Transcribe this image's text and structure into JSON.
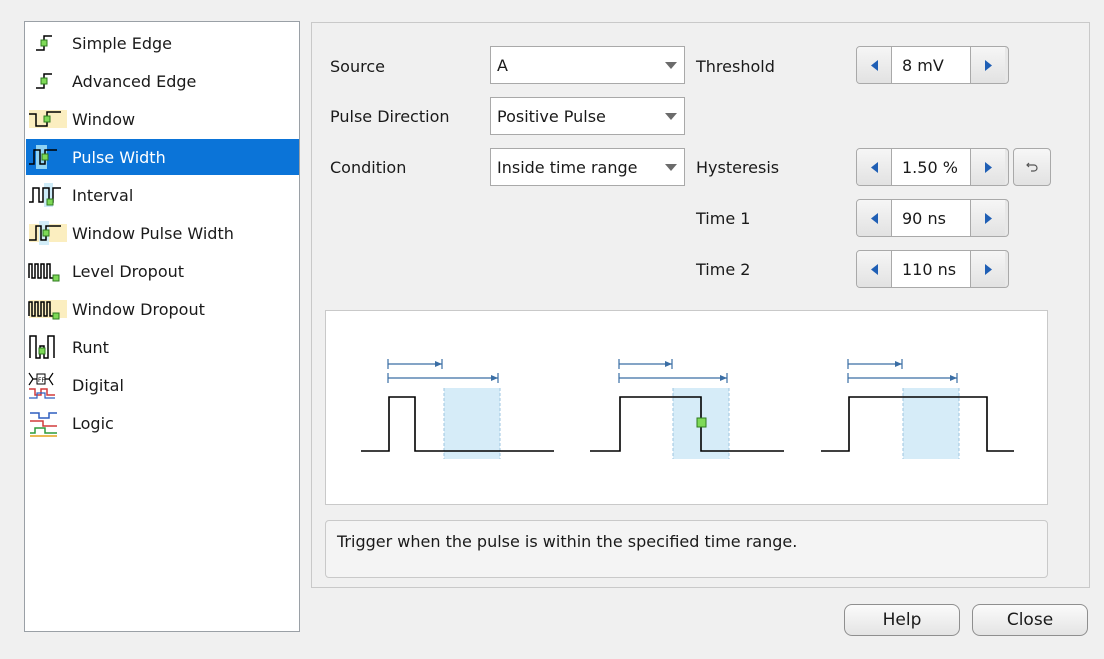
{
  "trigger_types": [
    {
      "label": "Simple Edge",
      "icon": "simple-edge-icon"
    },
    {
      "label": "Advanced Edge",
      "icon": "advanced-edge-icon"
    },
    {
      "label": "Window",
      "icon": "window-icon"
    },
    {
      "label": "Pulse Width",
      "icon": "pulse-width-icon",
      "selected": true
    },
    {
      "label": "Interval",
      "icon": "interval-icon"
    },
    {
      "label": "Window Pulse Width",
      "icon": "window-pulse-width-icon"
    },
    {
      "label": "Level Dropout",
      "icon": "level-dropout-icon"
    },
    {
      "label": "Window Dropout",
      "icon": "window-dropout-icon"
    },
    {
      "label": "Runt",
      "icon": "runt-icon"
    },
    {
      "label": "Digital",
      "icon": "digital-icon"
    },
    {
      "label": "Logic",
      "icon": "logic-icon"
    }
  ],
  "settings": {
    "source_label": "Source",
    "source_value": "A",
    "pulse_direction_label": "Pulse Direction",
    "pulse_direction_value": "Positive Pulse",
    "condition_label": "Condition",
    "condition_value": "Inside time range",
    "threshold_label": "Threshold",
    "threshold_value": "8 mV",
    "hysteresis_label": "Hysteresis",
    "hysteresis_value": "1.50 %",
    "time1_label": "Time 1",
    "time1_value": "90 ns",
    "time2_label": "Time 2",
    "time2_value": "110 ns"
  },
  "description": "Trigger when the pulse is within the specified time range.",
  "buttons": {
    "help": "Help",
    "close": "Close"
  },
  "colors": {
    "selection": "#0b74d8",
    "accent_blue": "#3a6ea5",
    "window_fill": "#d6ecf8",
    "trigger_marker": "#7ed957",
    "waveform": "#000000"
  }
}
